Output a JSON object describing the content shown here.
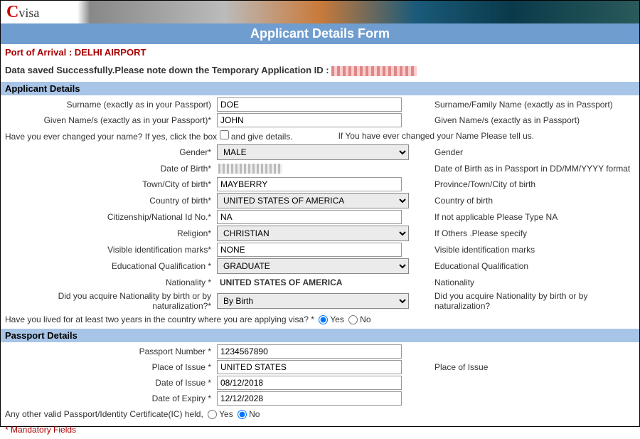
{
  "logo_text": "visa",
  "title_bar": "Applicant Details Form",
  "port": {
    "label": "Port of Arrival :",
    "value": "DELHI AIRPORT"
  },
  "save_msg": {
    "part1": "Data saved Successfully.",
    "part2": "Please note down the Temporary Application ID :"
  },
  "sections": {
    "applicant": "Applicant Details",
    "passport": "Passport Details"
  },
  "labels": {
    "surname": "Surname (exactly as in your Passport)",
    "given": "Given Name/s (exactly as in your Passport)*",
    "name_change_q": "Have you ever changed your name? If yes, click the box",
    "name_change_after": "and give details.",
    "gender": "Gender*",
    "dob": "Date of Birth*",
    "town": "Town/City of birth*",
    "cob": "Country of birth*",
    "cid": "Citizenship/National Id No.*",
    "religion": "Religion*",
    "marks": "Visible identification marks*",
    "edu": "Educational Qualification *",
    "nat": "Nationality *",
    "acq": "Did you acquire Nationality by birth or by naturalization?*",
    "two_year": "Have you lived for at least two years in the country where you are applying visa? *",
    "ppno": "Passport Number *",
    "poi": "Place of Issue *",
    "doi": "Date of Issue *",
    "doe": "Date of Expiry *",
    "other_pp": "Any other valid Passport/Identity Certificate(IC) held,",
    "yes": "Yes",
    "no": "No"
  },
  "help": {
    "surname": "Surname/Family Name (exactly as in Passport)",
    "given": "Given Name/s (exactly as in Passport)",
    "name_change": "If You have ever changed your Name Please tell us.",
    "gender": "Gender",
    "dob": "Date of Birth as in Passport in DD/MM/YYYY format",
    "town": "Province/Town/City of birth",
    "cob": "Country of birth",
    "cid": "If not applicable Please Type NA",
    "religion": "If Others .Please specify",
    "marks": "Visible identification marks",
    "edu": "Educational Qualification",
    "nat": "Nationality",
    "acq": "Did you acquire Nationality by birth or by naturalization?",
    "poi": "Place of Issue"
  },
  "values": {
    "surname": "DOE",
    "given": "JOHN",
    "gender": "MALE",
    "town": "MAYBERRY",
    "cob": "UNITED STATES OF AMERICA",
    "cid": "NA",
    "religion": "CHRISTIAN",
    "marks": "NONE",
    "edu": "GRADUATE",
    "nat": "UNITED STATES OF AMERICA",
    "acq": "By Birth",
    "ppno": "1234567890",
    "poi": "UNITED STATES",
    "doi": "08/12/2018",
    "doe": "12/12/2028"
  },
  "mandatory": "* Mandatory Fields"
}
